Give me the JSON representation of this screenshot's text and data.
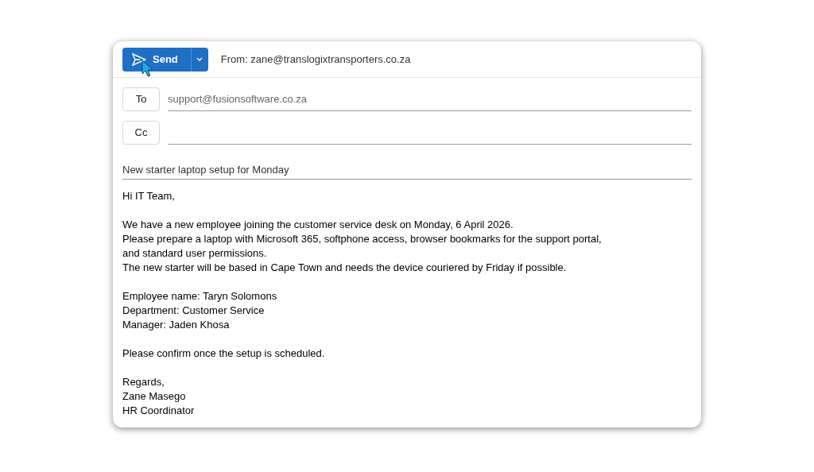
{
  "toolbar": {
    "send_label": "Send",
    "from": "From: zane@translogixtransporters.co.za"
  },
  "recipients": [
    {
      "label": "To",
      "value": "support@fusionsoftware.co.za"
    },
    {
      "label": "Cc"
    }
  ],
  "subject": "New starter laptop setup for Monday",
  "body": [
    [
      "Hi IT Team,"
    ],
    [
      "We have a new employee joining the customer service desk on Monday, 6 April 2026.",
      "Please prepare a laptop with Microsoft 365, softphone access, browser bookmarks for the support portal,",
      "and standard user permissions.",
      "The new starter will be based in Cape Town and needs the device couriered by Friday if possible."
    ],
    [
      "Employee name: Taryn Solomons",
      "Department: Customer Service",
      "Manager: Jaden Khosa"
    ],
    [
      "Please confirm once the setup is scheduled."
    ],
    [
      "Regards,",
      "Zane Masego",
      "HR Coordinator"
    ]
  ]
}
